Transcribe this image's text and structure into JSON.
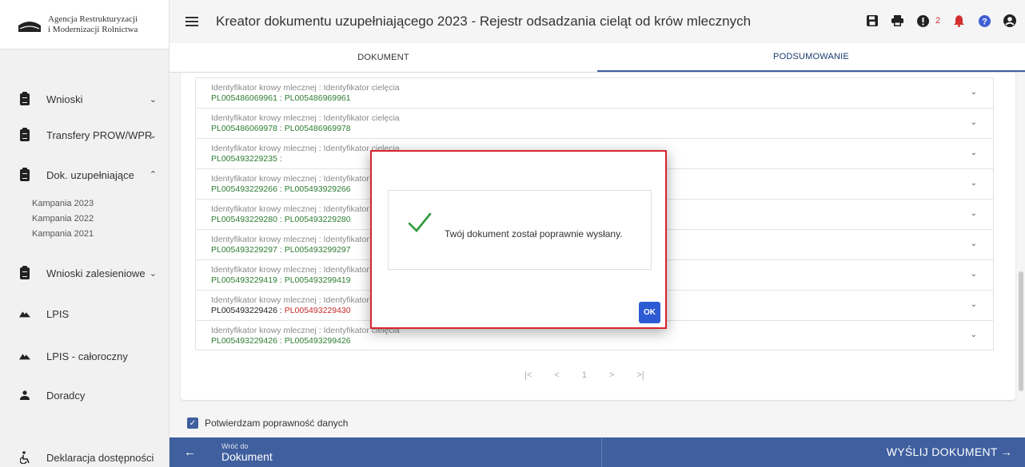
{
  "logo": {
    "line1": "Agencja Restrukturyzacji",
    "line2": "i Modernizacji Rolnictwa"
  },
  "header": {
    "title": "Kreator dokumentu uzupełniającego 2023 - Rejestr odsadzania cieląt od krów mlecznych",
    "notifications_count": "2",
    "icons": [
      "save-icon",
      "print-icon",
      "alert-icon",
      "bell-icon",
      "help-icon",
      "user-icon"
    ]
  },
  "tabs": [
    {
      "label": "DOKUMENT",
      "active": false
    },
    {
      "label": "PODSUMOWANIE",
      "active": true
    }
  ],
  "sidebar": {
    "items": [
      {
        "label": "Wnioski",
        "icon": "clipboard-icon",
        "chevron": "down"
      },
      {
        "label": "Transfery PROW/WPR",
        "icon": "clipboard-icon",
        "chevron": "down"
      },
      {
        "label": "Dok. uzupełniające",
        "icon": "clipboard-icon",
        "chevron": "up"
      },
      {
        "label": "Wnioski zalesieniowe",
        "icon": "clipboard-icon",
        "chevron": "down"
      },
      {
        "label": "LPIS",
        "icon": "terrain-icon"
      },
      {
        "label": "LPIS - całoroczny",
        "icon": "terrain-icon"
      },
      {
        "label": "Doradcy",
        "icon": "person-icon"
      },
      {
        "label": "Deklaracja dostępności",
        "icon": "accessibility-icon"
      }
    ],
    "subitems": [
      "Kampania 2023",
      "Kampania 2022",
      "Kampania 2021"
    ]
  },
  "list": {
    "label": "Identyfikator krowy mlecznej : Identyfikator cielęcia",
    "rows": [
      {
        "a": "PL005486069961",
        "sep": " : ",
        "b": "PL005486969961",
        "a_style": "green",
        "b_style": "green"
      },
      {
        "a": "PL005486069978",
        "sep": " : ",
        "b": "PL005486969978",
        "a_style": "green",
        "b_style": "green"
      },
      {
        "a": "PL005493229235",
        "sep": " :",
        "b": "",
        "a_style": "green",
        "b_style": "green"
      },
      {
        "a": "PL005493229266",
        "sep": " : ",
        "b": "PL005493929266",
        "a_style": "green",
        "b_style": "green"
      },
      {
        "a": "PL005493229280",
        "sep": " : ",
        "b": "PL005493229280",
        "a_style": "green",
        "b_style": "green"
      },
      {
        "a": "PL005493229297",
        "sep": " : ",
        "b": "PL005493299297",
        "a_style": "green",
        "b_style": "green"
      },
      {
        "a": "PL005493229419",
        "sep": " : ",
        "b": "PL005493299419",
        "a_style": "green",
        "b_style": "green"
      },
      {
        "a": "PL005493229426",
        "sep": " : ",
        "b": "PL005493229430",
        "a_style": "dark",
        "b_style": "red"
      },
      {
        "a": "PL005493229426",
        "sep": " : ",
        "b": "PL005493299426",
        "a_style": "green",
        "b_style": "green"
      }
    ]
  },
  "pager": {
    "first": "|<",
    "prev": "<",
    "page": "1",
    "next": ">",
    "last": ">|"
  },
  "confirm": {
    "label": "Potwierdzam poprawność danych",
    "checked": true
  },
  "bottom": {
    "back_small": "Wróć do",
    "back_big": "Dokument",
    "send": "WYŚLIJ DOKUMENT →"
  },
  "modal": {
    "message": "Twój dokument został poprawnie wysłany.",
    "ok": "OK"
  },
  "colors": {
    "primary": "#3f5f9e",
    "green_text": "#2e7d32",
    "error": "#c62828",
    "modal_border": "#d9232e",
    "ok": "#2d5bd4"
  }
}
